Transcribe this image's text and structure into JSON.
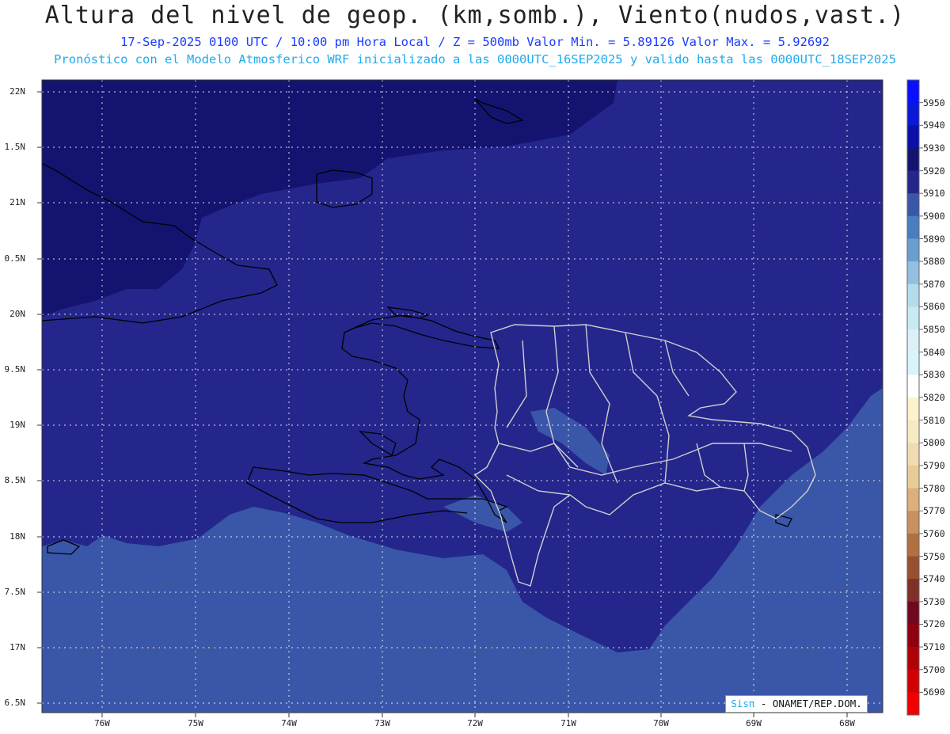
{
  "header": {
    "title": "Altura del nivel de geop. (km,somb.), Viento(nudos,vast.)",
    "line1": "17-Sep-2025  0100 UTC / 10:00 pm Hora Local / Z = 500mb   Valor Min. = 5.89126  Valor Max. = 5.92692",
    "line2": "Pronóstico con el Modelo Atmosferico WRF inicializado a las 0000UTC_16SEP2025 y valido hasta las  0000UTC_18SEP2025"
  },
  "axes": {
    "lat_labels": [
      "22N",
      "1.5N",
      "21N",
      "0.5N",
      "20N",
      "9.5N",
      "19N",
      "8.5N",
      "18N",
      "7.5N",
      "17N",
      "6.5N"
    ],
    "lon_labels": [
      "76W",
      "75W",
      "74W",
      "73W",
      "72W",
      "71W",
      "70W",
      "69W",
      "68W"
    ]
  },
  "colorbar": {
    "labels": [
      "5950",
      "5940",
      "5930",
      "5920",
      "5910",
      "5900",
      "5890",
      "5880",
      "5870",
      "5860",
      "5850",
      "5840",
      "5830",
      "5820",
      "5810",
      "5800",
      "5790",
      "5780",
      "5770",
      "5760",
      "5750",
      "5740",
      "5730",
      "5720",
      "5710",
      "5700",
      "5690"
    ],
    "colors": [
      "#0a10ff",
      "#0a18d8",
      "#0a10a8",
      "#141470",
      "#24268c",
      "#3a56a8",
      "#4a7ec0",
      "#6a9ed0",
      "#94c0e0",
      "#b4dcec",
      "#c8eaf2",
      "#dcf0f8",
      "#d8f4fa",
      "#ffffff",
      "#fcf2cc",
      "#f6eac4",
      "#f0dcb0",
      "#e8cc98",
      "#dcb07c",
      "#c89060",
      "#b07040",
      "#985030",
      "#803028",
      "#700820",
      "#900010",
      "#b00008",
      "#d00004",
      "#f00000"
    ]
  },
  "credit": {
    "sis": "Sisπ",
    "rest": " - ONAMET/REP.DOM."
  }
}
